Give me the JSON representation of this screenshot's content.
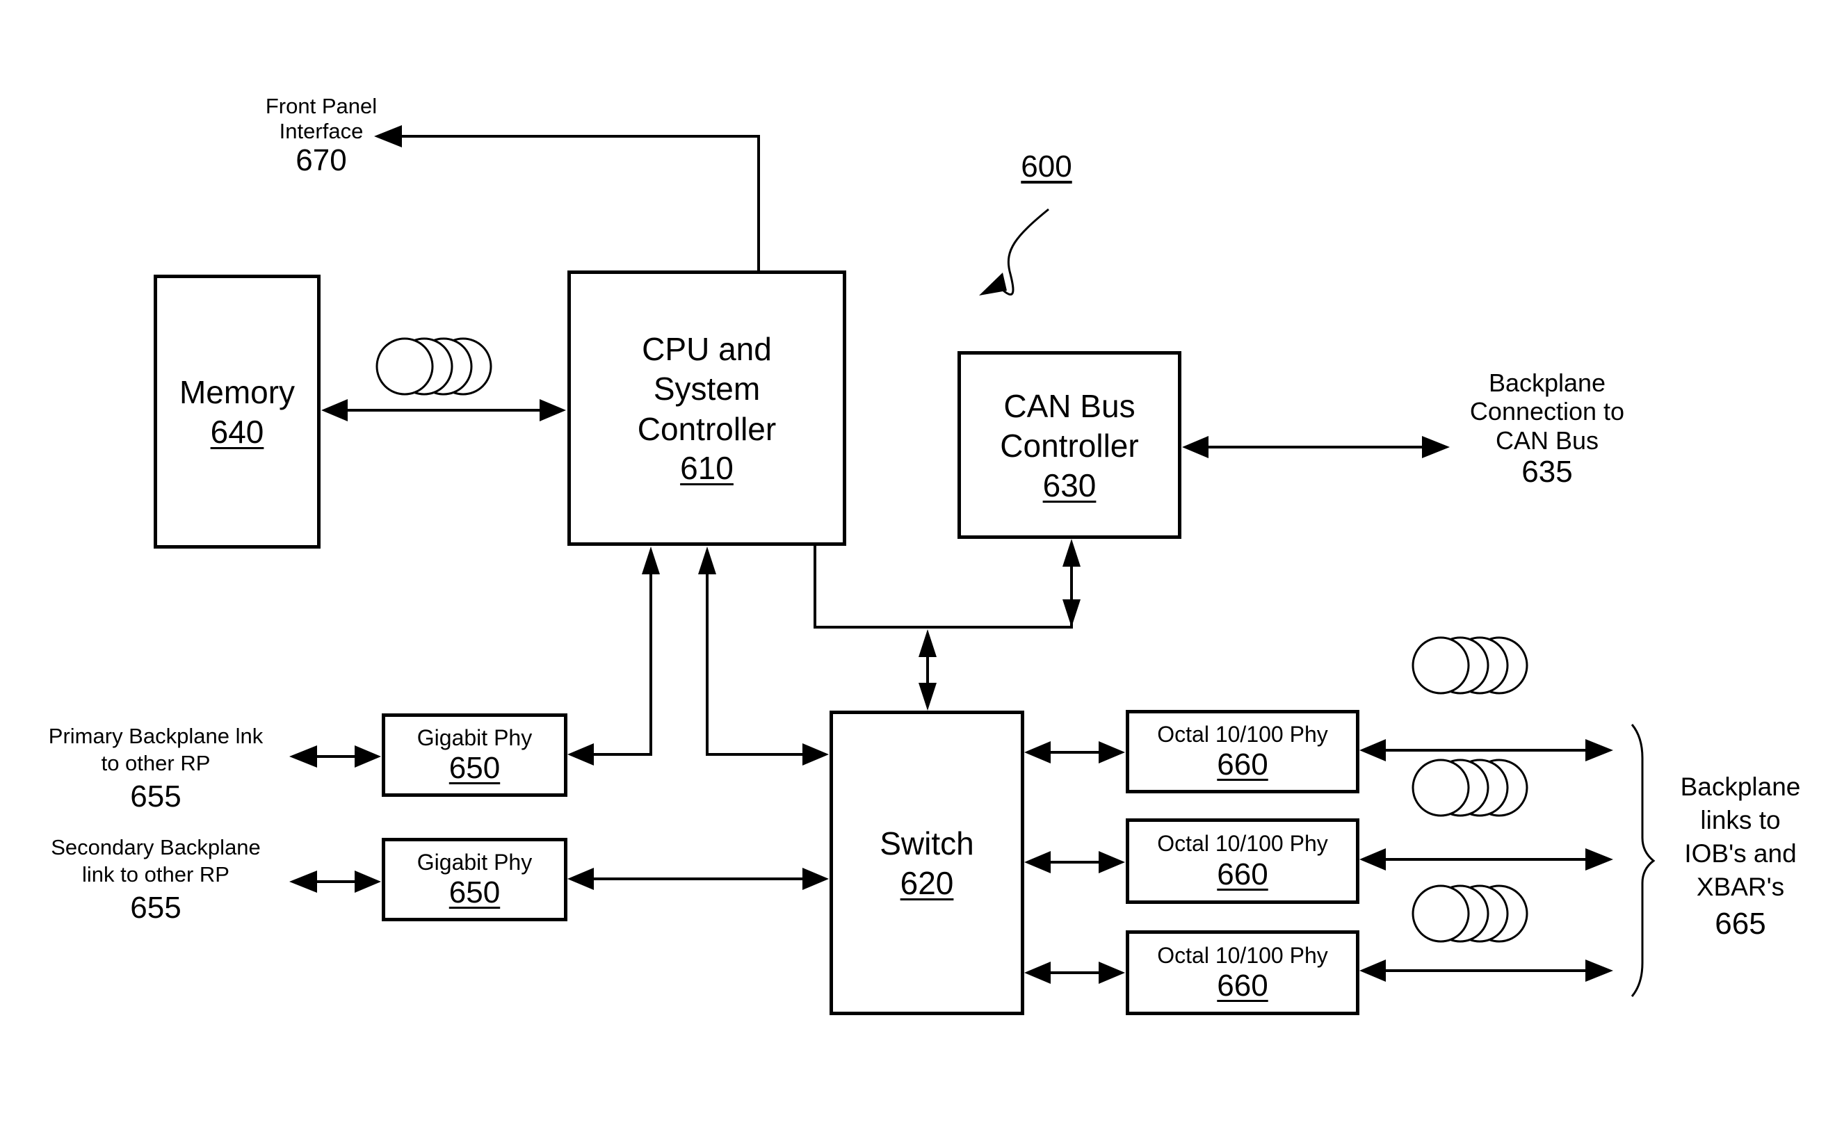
{
  "figure": {
    "reference": "600"
  },
  "blocks": {
    "memory": {
      "title": "Memory",
      "number": "640"
    },
    "cpu": {
      "title_lines": [
        "CPU and",
        "System",
        "Controller"
      ],
      "number": "610"
    },
    "can": {
      "title_lines": [
        "CAN Bus",
        "Controller"
      ],
      "number": "630"
    },
    "switch": {
      "title": "Switch",
      "number": "620"
    },
    "gigabit": [
      {
        "title": "Gigabit Phy",
        "number": "650"
      },
      {
        "title": "Gigabit Phy",
        "number": "650"
      }
    ],
    "octal": [
      {
        "title": "Octal 10/100 Phy",
        "number": "660"
      },
      {
        "title": "Octal 10/100 Phy",
        "number": "660"
      },
      {
        "title": "Octal 10/100 Phy",
        "number": "660"
      }
    ]
  },
  "external_labels": {
    "front_panel": {
      "lines": [
        "Front Panel",
        "Interface"
      ],
      "number": "670"
    },
    "can_backplane": {
      "lines": [
        "Backplane",
        "Connection to",
        "CAN Bus"
      ],
      "number": "635"
    },
    "primary_link": {
      "lines": [
        "Primary Backplane lnk",
        "to other RP"
      ],
      "number": "655"
    },
    "secondary_link": {
      "lines": [
        "Secondary Backplane",
        "link to other RP"
      ],
      "number": "655"
    },
    "iob_links": {
      "lines": [
        "Backplane",
        "links to",
        "IOB's and",
        "XBAR's"
      ],
      "number": "665"
    }
  },
  "icons": {
    "disk_stack": "disk-stack-icon"
  }
}
